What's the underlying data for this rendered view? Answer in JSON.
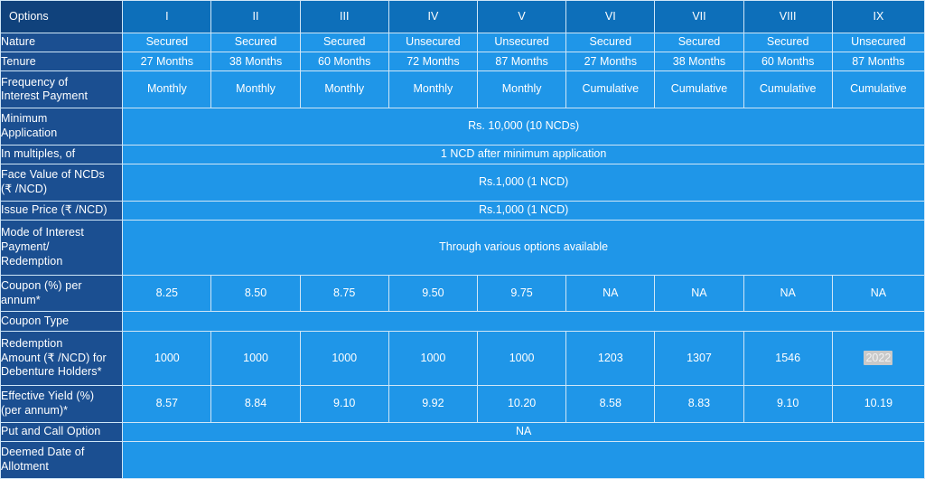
{
  "table": {
    "title": "NCD Issue Terms Comparison Table",
    "colors": {
      "label_bg": "#1b4f91",
      "header_bg": "#0d6fba",
      "data_bg": "#1f96e8",
      "grid": "#cfe6f7",
      "text": "#ffffff",
      "selection_highlight": "#c9c9c9"
    },
    "header": {
      "label": "Options",
      "columns": [
        "I",
        "II",
        "III",
        "IV",
        "V",
        "VI",
        "VII",
        "VIII",
        "IX"
      ]
    },
    "rows": [
      {
        "label": "Nature",
        "type": "cells",
        "values": [
          "Secured",
          "Secured",
          "Secured",
          "Unsecured",
          "Unsecured",
          "Secured",
          "Secured",
          "Secured",
          "Unsecured"
        ]
      },
      {
        "label": "Tenure",
        "type": "cells",
        "values": [
          "27 Months",
          "38 Months",
          "60 Months",
          "72 Months",
          "87 Months",
          "27 Months",
          "38 Months",
          "60 Months",
          "87 Months"
        ]
      },
      {
        "label": "Frequency of\nInterest Payment",
        "label_lines": [
          "Frequency of",
          "Interest Payment"
        ],
        "type": "cells",
        "values": [
          "Monthly",
          "Monthly",
          "Monthly",
          "Monthly",
          "Monthly",
          "Cumulative",
          "Cumulative",
          "Cumulative",
          "Cumulative"
        ]
      },
      {
        "label": "Minimum Application",
        "label_lines": [
          "Minimum",
          "Application"
        ],
        "type": "merged",
        "value": "Rs. 10,000 (10 NCDs)"
      },
      {
        "label": "In multiples, of",
        "label_lines": [
          "In multiples, of"
        ],
        "type": "merged",
        "value": "1 NCD after minimum application"
      },
      {
        "label": "Face Value of NCDs (₹ /NCD)",
        "label_lines": [
          "Face Value of NCDs",
          "(₹ /NCD)"
        ],
        "type": "merged",
        "value": "Rs.1,000 (1 NCD)"
      },
      {
        "label": "Issue Price (₹ /NCD)",
        "label_lines": [
          "Issue Price (₹ /NCD)"
        ],
        "type": "merged",
        "value": "Rs.1,000 (1 NCD)"
      },
      {
        "label": "Mode of Interest Payment/ Redemption",
        "label_lines": [
          "Mode of Interest",
          "Payment/",
          "Redemption"
        ],
        "type": "merged",
        "value": "Through various options available"
      },
      {
        "label": "Coupon (%) per annum*",
        "label_lines": [
          "Coupon (%) per",
          "annum*"
        ],
        "type": "cells",
        "values": [
          "8.25",
          "8.50",
          "8.75",
          "9.50",
          "9.75",
          "NA",
          "NA",
          "NA",
          "NA"
        ]
      },
      {
        "label": "Coupon Type",
        "label_lines": [
          "Coupon Type"
        ],
        "type": "merged",
        "value": ""
      },
      {
        "label": "Redemption Amount (₹ /NCD) for Debenture Holders*",
        "label_lines": [
          "Redemption",
          "Amount (₹ /NCD) for",
          "Debenture Holders*"
        ],
        "type": "cells",
        "values": [
          "1000",
          "1000",
          "1000",
          "1000",
          "1000",
          "1203",
          "1307",
          "1546",
          "2022"
        ],
        "selected_index": 8
      },
      {
        "label": "Effective Yield (%) (per annum)*",
        "label_lines": [
          "Effective Yield (%)",
          "(per annum)*"
        ],
        "type": "cells",
        "values": [
          "8.57",
          "8.84",
          "9.10",
          "9.92",
          "10.20",
          "8.58",
          "8.83",
          "9.10",
          "10.19"
        ]
      },
      {
        "label": "Put and Call Option",
        "label_lines": [
          "Put and Call Option"
        ],
        "type": "merged",
        "value": "NA"
      },
      {
        "label": "Deemed Date of Allotment",
        "label_lines": [
          "Deemed Date of",
          "Allotment"
        ],
        "type": "merged",
        "value": ""
      }
    ]
  }
}
